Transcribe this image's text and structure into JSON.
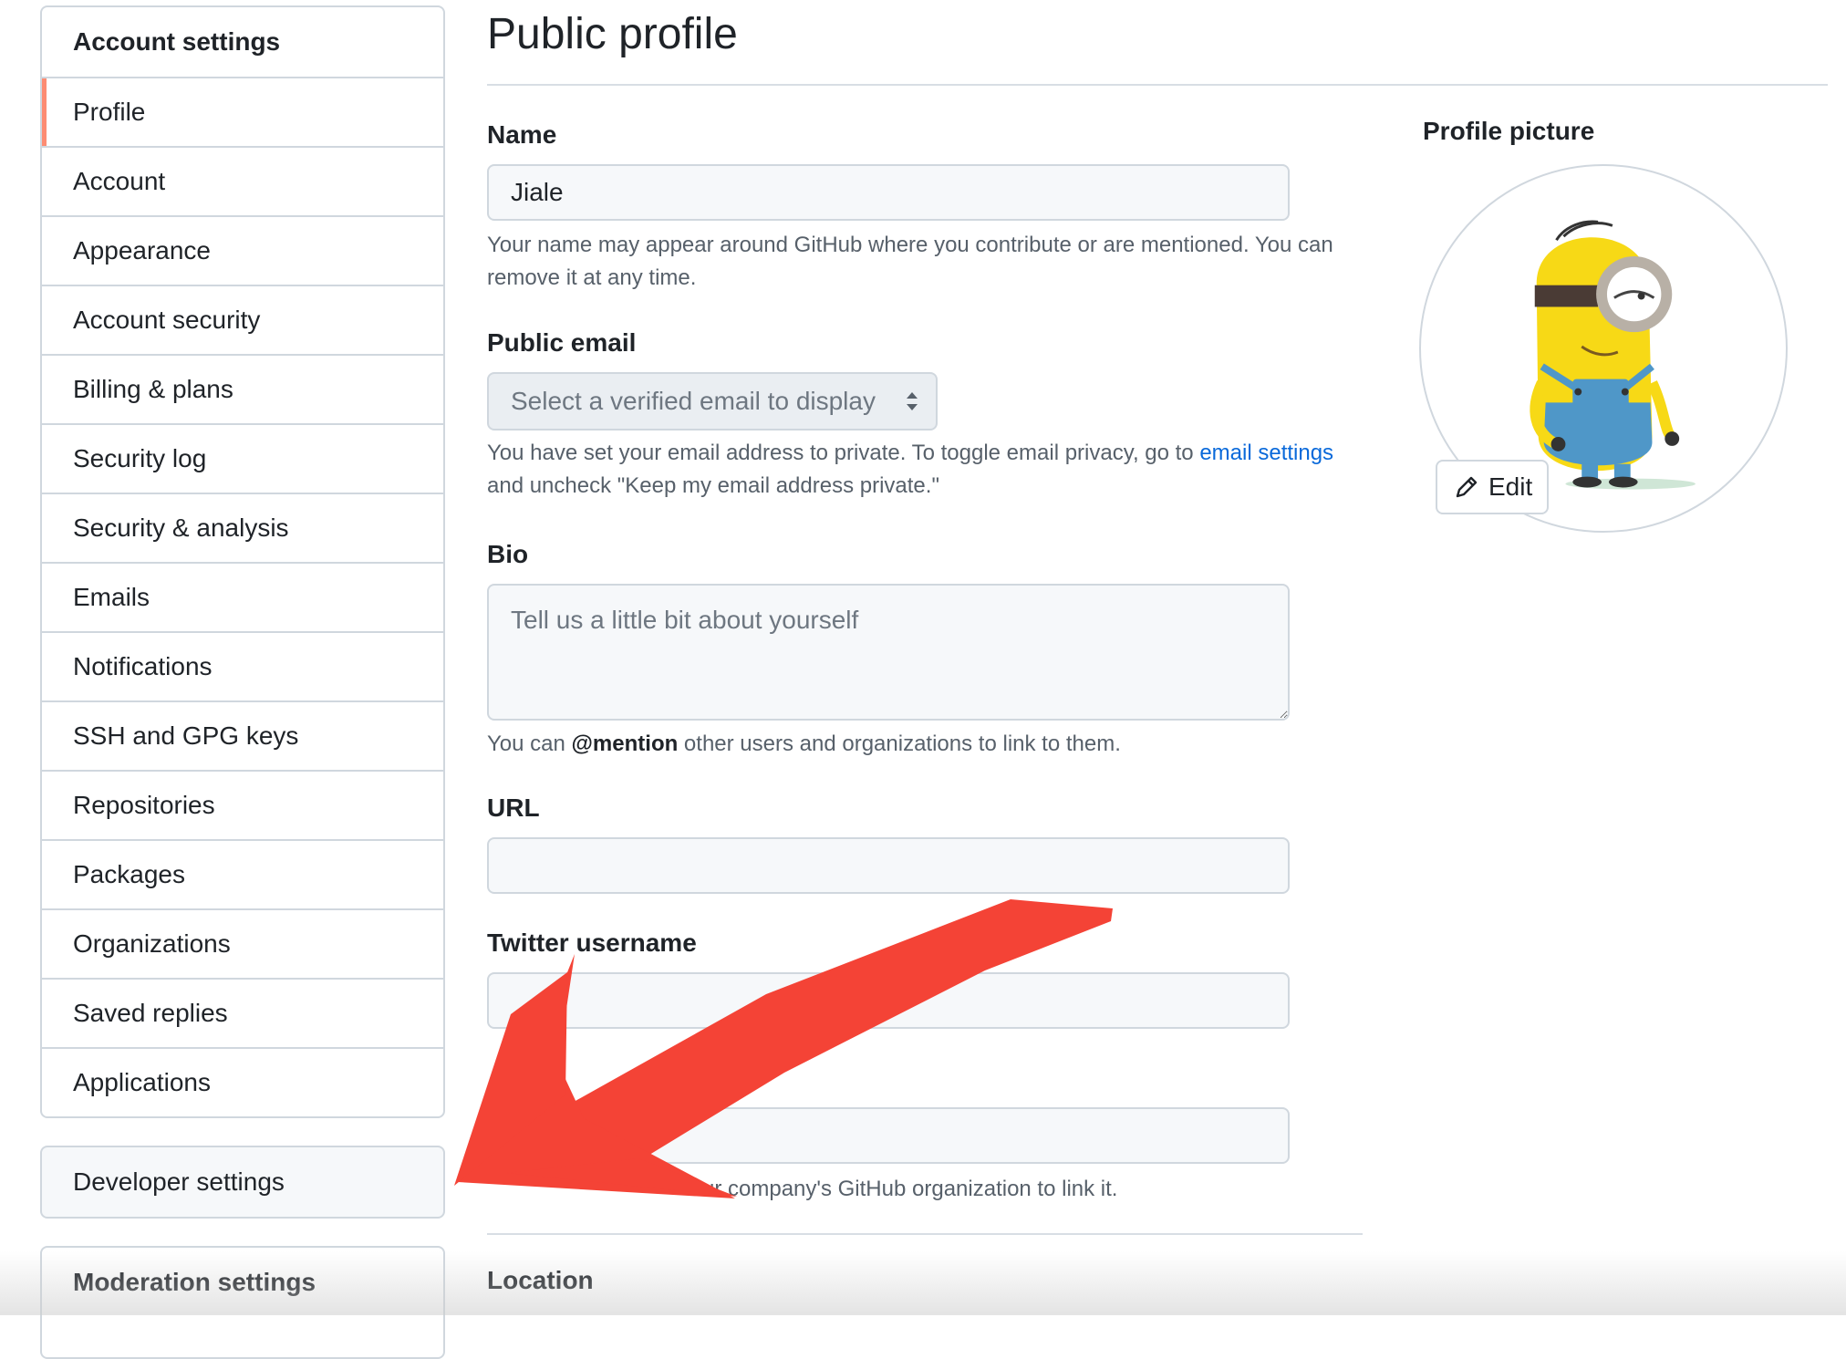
{
  "sidebar": {
    "header": "Account settings",
    "items": [
      {
        "label": "Profile",
        "selected": true
      },
      {
        "label": "Account"
      },
      {
        "label": "Appearance"
      },
      {
        "label": "Account security"
      },
      {
        "label": "Billing & plans"
      },
      {
        "label": "Security log"
      },
      {
        "label": "Security & analysis"
      },
      {
        "label": "Emails"
      },
      {
        "label": "Notifications"
      },
      {
        "label": "SSH and GPG keys"
      },
      {
        "label": "Repositories"
      },
      {
        "label": "Packages"
      },
      {
        "label": "Organizations"
      },
      {
        "label": "Saved replies"
      },
      {
        "label": "Applications"
      }
    ],
    "developer_settings": "Developer settings",
    "moderation_settings": "Moderation settings",
    "selected_accent": "#fd8c73"
  },
  "main": {
    "title": "Public profile",
    "name": {
      "label": "Name",
      "value": "Jiale",
      "note": "Your name may appear around GitHub where you contribute or are mentioned. You can remove it at any time."
    },
    "public_email": {
      "label": "Public email",
      "selected": "Select a verified email to display",
      "note_before": "You have set your email address to private. To toggle email privacy, go to ",
      "note_link": "email settings",
      "note_after": " and uncheck \"Keep my email address private.\""
    },
    "bio": {
      "label": "Bio",
      "placeholder": "Tell us a little bit about yourself",
      "note_before": "You can ",
      "note_bold": "@mention",
      "note_after": " other users and organizations to link to them."
    },
    "url": {
      "label": "URL",
      "value": ""
    },
    "twitter": {
      "label": "Twitter username",
      "value": ""
    },
    "company": {
      "value": "",
      "note_visible": "ur company's GitHub organization to link it."
    },
    "location": {
      "label": "Location"
    }
  },
  "profile_picture": {
    "label": "Profile picture",
    "avatar_icon": "minion-avatar",
    "edit_label": "Edit",
    "edit_icon": "pencil-icon"
  },
  "annotation": {
    "icon": "red-arrow-annotation",
    "color": "#f44336"
  },
  "colors": {
    "link": "#0969da",
    "border": "#d0d7de",
    "field_bg": "#f6f8fa",
    "muted_text": "#57606a"
  }
}
